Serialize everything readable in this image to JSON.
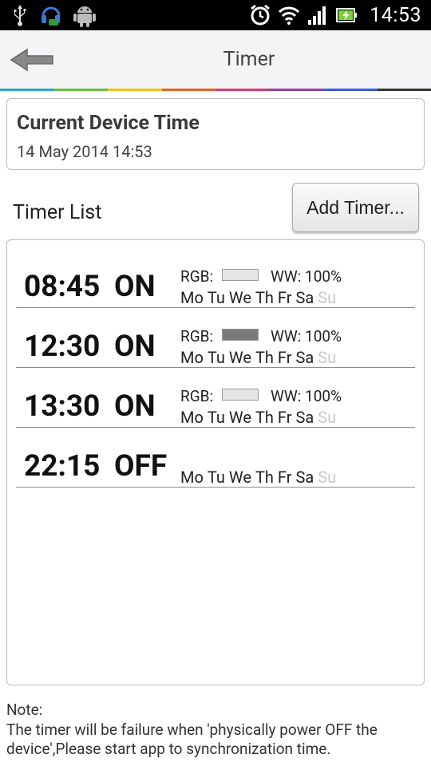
{
  "status_bar": {
    "time": "14:53",
    "left_icons": [
      "usb-icon",
      "headset-notification-icon",
      "android-icon"
    ],
    "right_icons": [
      "alarm-clock-icon",
      "wifi-icon",
      "signal-icon",
      "battery-charging-icon"
    ]
  },
  "title_bar": {
    "title": "Timer",
    "back_icon": "back-arrow-icon",
    "rainbow_colors": [
      "#2aa7c9",
      "#6bbf3f",
      "#f0c419",
      "#e8632b",
      "#d23c6e",
      "#8e44ad",
      "#3b5bdb",
      "#333333"
    ]
  },
  "device_time": {
    "label": "Current Device Time",
    "value": "14 May 2014 14:53"
  },
  "timer_list": {
    "title": "Timer List",
    "add_button": "Add Timer...",
    "rgb_label": "RGB:",
    "day_labels": [
      "Mo",
      "Tu",
      "We",
      "Th",
      "Fr",
      "Sa",
      "Su"
    ],
    "timers": [
      {
        "time": "08:45",
        "state": "ON",
        "rgb_color": "#e6e6e6",
        "ww": "WW: 100%",
        "days_on": [
          true,
          true,
          true,
          true,
          true,
          true,
          false
        ]
      },
      {
        "time": "12:30",
        "state": "ON",
        "rgb_color": "#7a7a7a",
        "ww": "WW: 100%",
        "days_on": [
          true,
          true,
          true,
          true,
          true,
          true,
          false
        ]
      },
      {
        "time": "13:30",
        "state": "ON",
        "rgb_color": "#e6e6e6",
        "ww": "WW: 100%",
        "days_on": [
          true,
          true,
          true,
          true,
          true,
          true,
          false
        ]
      },
      {
        "time": "22:15",
        "state": "OFF",
        "rgb_color": null,
        "ww": "",
        "days_on": [
          true,
          true,
          true,
          true,
          true,
          true,
          false
        ]
      }
    ]
  },
  "note": {
    "heading": "Note:",
    "text": "The timer will be failure when 'physically power OFF the device',Please start app to synchronization time."
  }
}
